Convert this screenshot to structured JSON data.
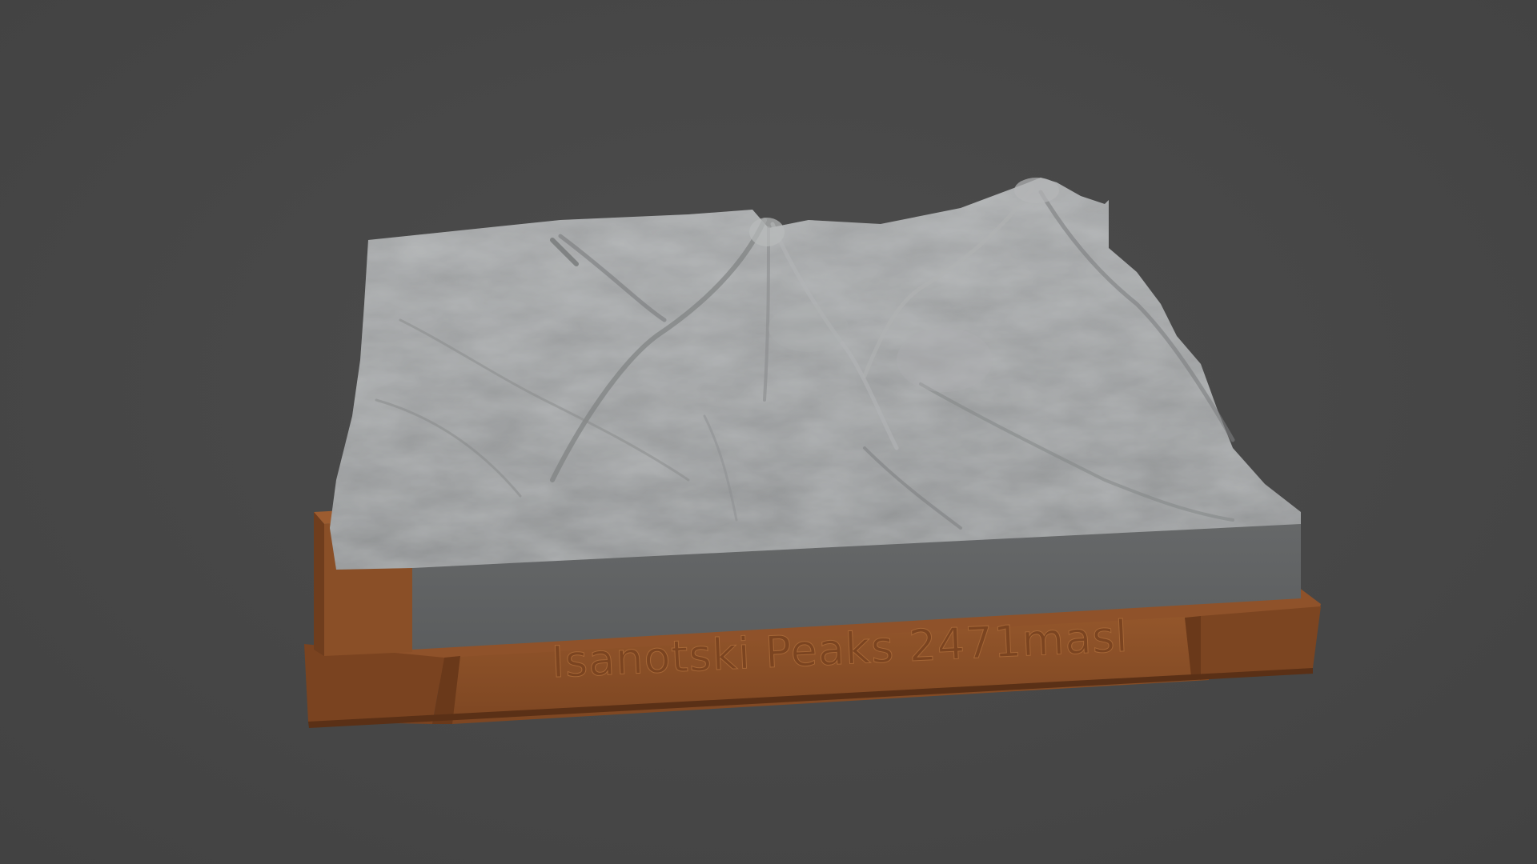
{
  "scene": {
    "background_color": "#474747",
    "terrain_color": "#9a9c9d",
    "terrain_side_color": "#5f6162",
    "base_color": "#8b4f27",
    "base_shadow_color": "#6a3a1c"
  },
  "plaque": {
    "text": "Isanotski Peaks 2471masl"
  },
  "legend_block": {
    "icons": [
      "north-arrow-icon",
      "scale-bar-icon"
    ]
  }
}
